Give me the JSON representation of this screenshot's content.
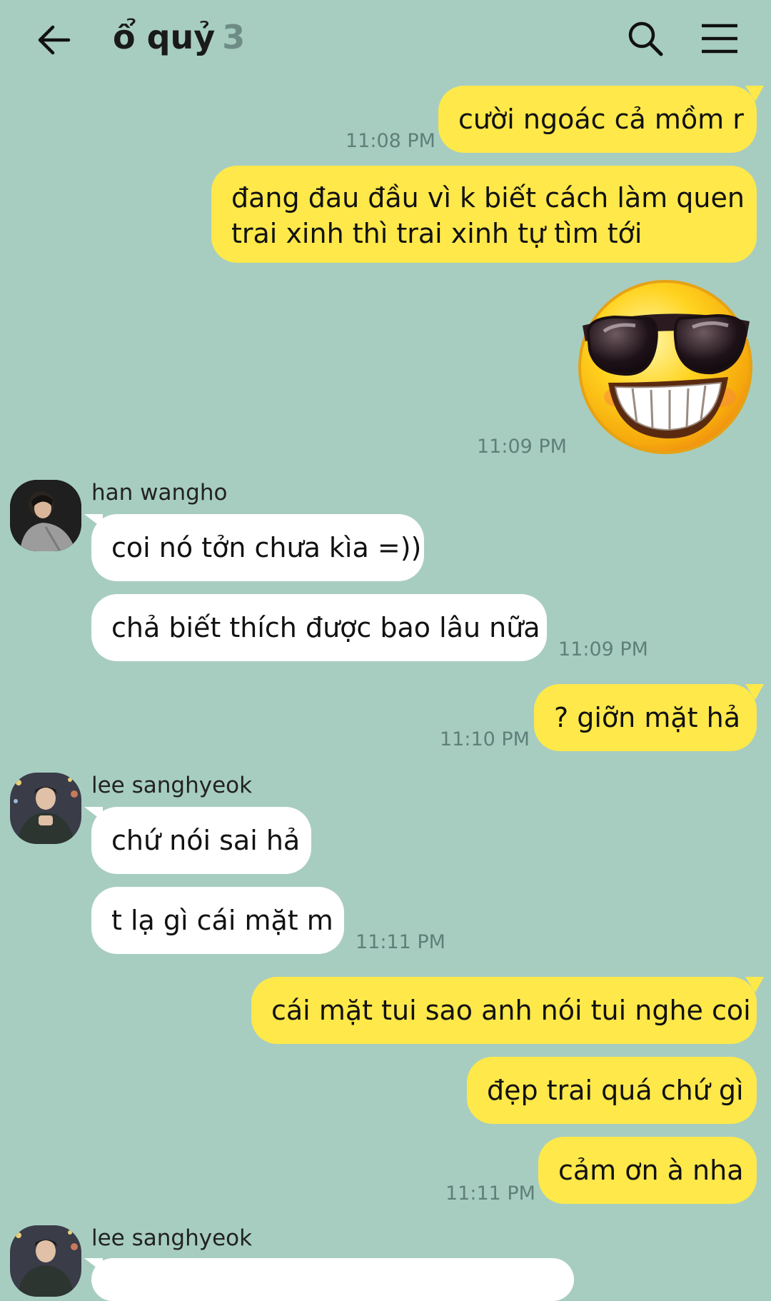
{
  "header": {
    "title": "ổ quỷ",
    "member_count": "3"
  },
  "colors": {
    "background": "#a7cdc1",
    "my_bubble": "#fee84a",
    "their_bubble": "#ffffff",
    "timestamp": "#5f7f78"
  },
  "messages": [
    {
      "from": "me",
      "text": "cười ngoác cả mồm r",
      "time": "11:08 PM"
    },
    {
      "from": "me",
      "text": "đang đau đầu vì k biết cách làm quen",
      "text2": "trai xinh thì trai xinh tự tìm tới"
    },
    {
      "from": "me",
      "sticker": "sunglasses-emoji",
      "time": "11:09 PM"
    },
    {
      "from": "han wangho",
      "text": "coi nó tởn chưa kìa =))"
    },
    {
      "from": "han wangho",
      "text": "chả biết thích được bao lâu nữa",
      "time": "11:09 PM"
    },
    {
      "from": "me",
      "text": "? giỡn mặt hả",
      "time": "11:10 PM"
    },
    {
      "from": "lee sanghyeok",
      "text": "chứ nói sai hả"
    },
    {
      "from": "lee sanghyeok",
      "text": "t lạ gì cái mặt m",
      "time": "11:11 PM"
    },
    {
      "from": "me",
      "text": "cái mặt tui sao anh nói tui nghe coi"
    },
    {
      "from": "me",
      "text": "đẹp trai quá chứ gì"
    },
    {
      "from": "me",
      "text": "cảm ơn à nha",
      "time": "11:11 PM"
    },
    {
      "from": "lee sanghyeok",
      "text": ""
    }
  ],
  "senders": {
    "han": "han wangho",
    "lee": "lee sanghyeok"
  }
}
